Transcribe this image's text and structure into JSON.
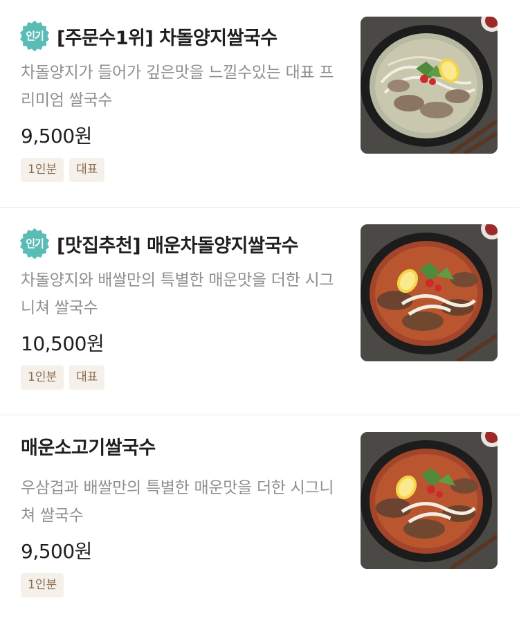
{
  "menu_items": [
    {
      "badge": "인기",
      "title": "[주문수1위] 차돌양지쌀국수",
      "description": "차돌양지가 들어가 깊은맛을 느낄수있는 대표 프리미엄 쌀국수",
      "price": "9,500원",
      "tags": [
        "1인분",
        "대표"
      ],
      "image": "clear-broth-pho-bowl"
    },
    {
      "badge": "인기",
      "title": "[맛집추천] 매운차돌양지쌀국수",
      "description": "차돌양지와 배쌀만의 특별한 매운맛을 더한 시그니쳐 쌀국수",
      "price": "10,500원",
      "tags": [
        "1인분",
        "대표"
      ],
      "image": "spicy-pho-bowl"
    },
    {
      "title": "매운소고기쌀국수",
      "description": "우삼겹과 배쌀만의 특별한 매운맛을 더한 시그니쳐 쌀국수",
      "price": "9,500원",
      "tags": [
        "1인분"
      ],
      "image": "spicy-beef-pho-bowl"
    }
  ],
  "colors": {
    "badge": "#5bbcb6",
    "tag_bg": "#f5f1ea",
    "tag_text": "#8a6a52",
    "desc_text": "#8f8f8f"
  }
}
